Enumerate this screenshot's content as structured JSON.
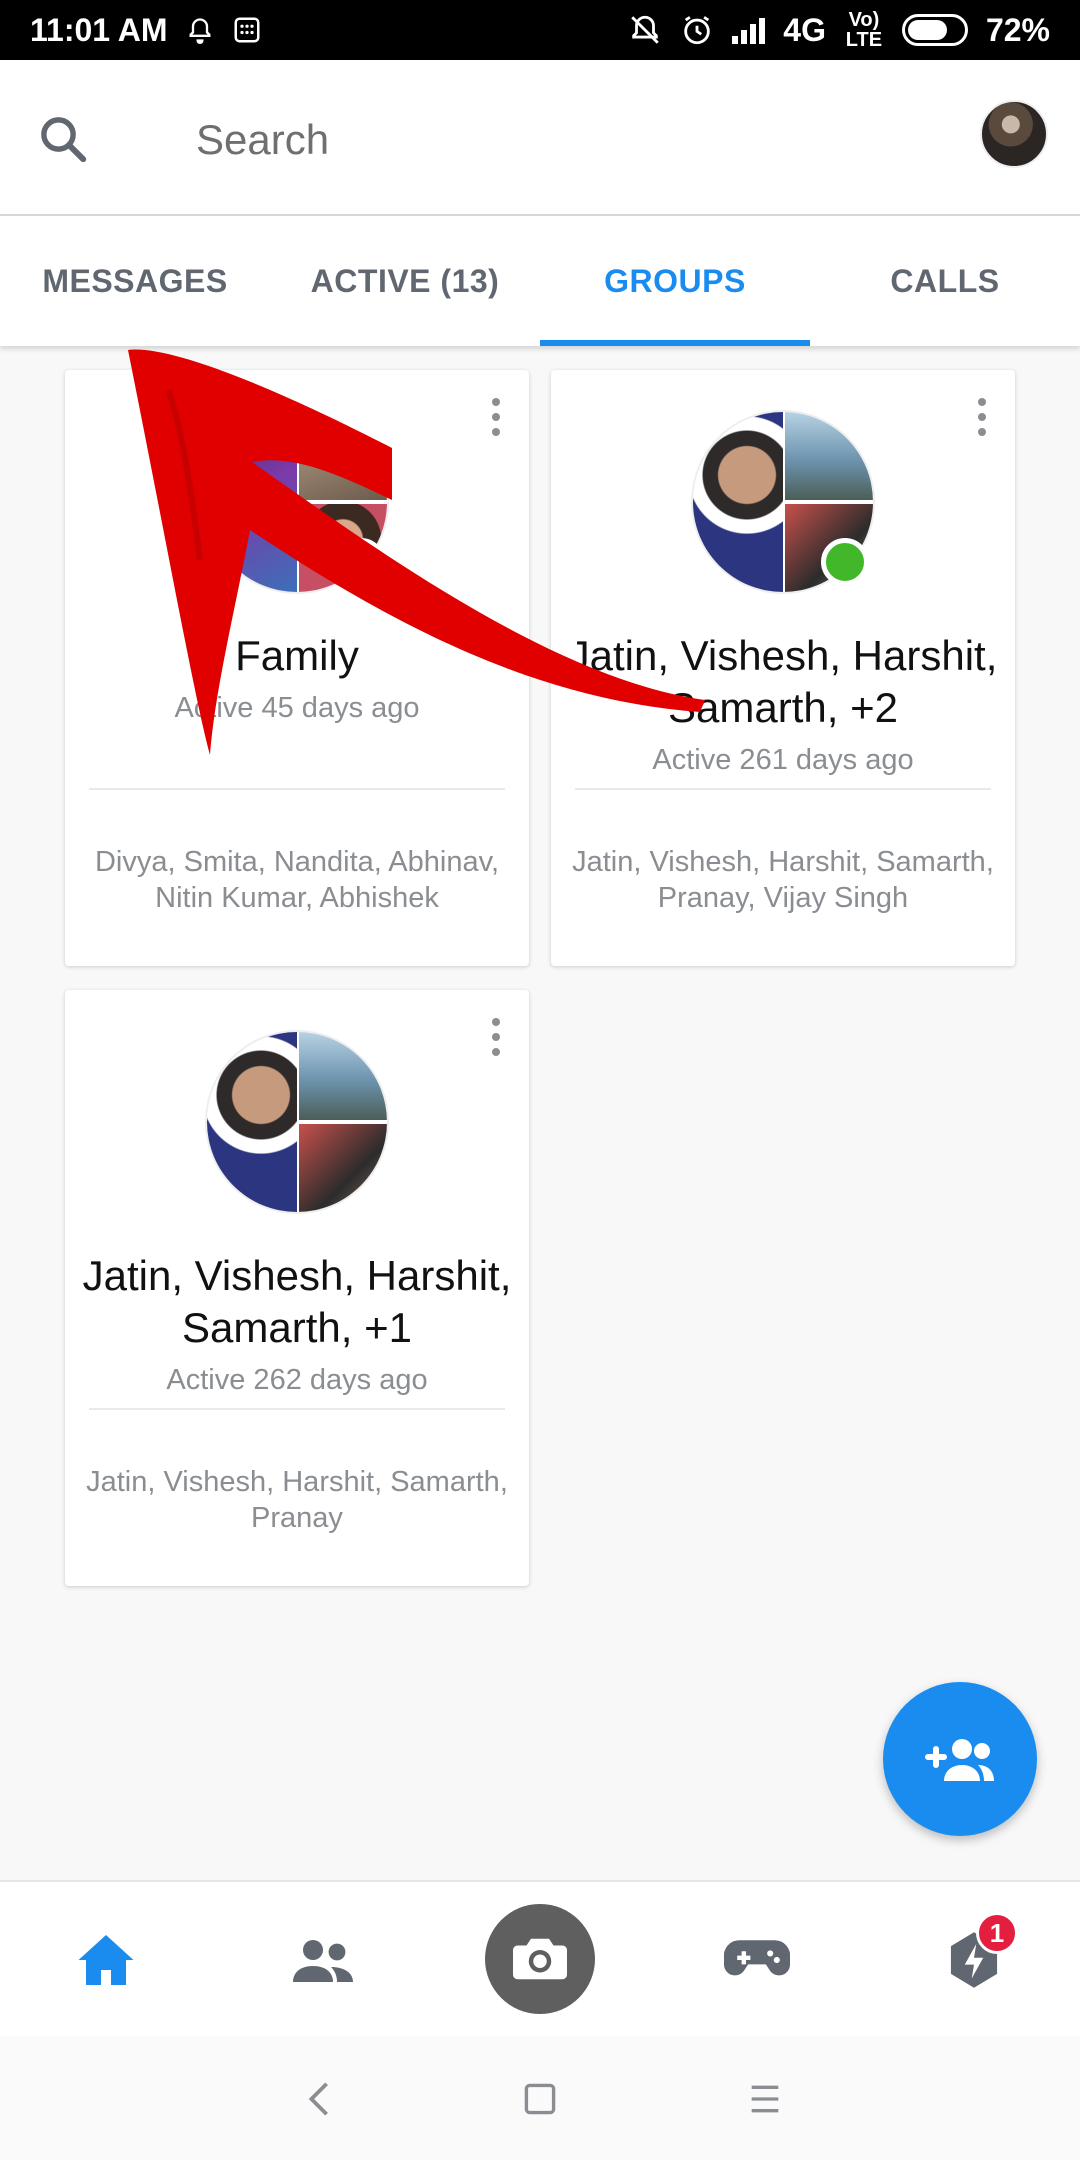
{
  "status_bar": {
    "time": "11:01 AM",
    "network": "4G",
    "volte": "Vo) LTE",
    "battery_percent": "72%",
    "battery_level": 0.72
  },
  "search": {
    "placeholder": "Search"
  },
  "tabs": [
    {
      "label": "MESSAGES",
      "active": false
    },
    {
      "label": "ACTIVE (13)",
      "active": false
    },
    {
      "label": "GROUPS",
      "active": true
    },
    {
      "label": "CALLS",
      "active": false
    }
  ],
  "groups": [
    {
      "title": "Family",
      "active": "Active 45 days ago",
      "members": "Divya, Smita, Nandita, Abhinav, Nitin Kumar, Abhishek",
      "online": true
    },
    {
      "title": "Jatin, Vishesh, Harshit, Samarth, +2",
      "active": "Active 261 days ago",
      "members": "Jatin, Vishesh, Harshit, Samarth, Pranay, Vijay Singh",
      "online": true
    },
    {
      "title": "Jatin, Vishesh, Harshit, Samarth, +1",
      "active": "Active 262 days ago",
      "members": "Jatin, Vishesh, Harshit, Samarth, Pranay",
      "online": false
    }
  ],
  "bottom_nav": {
    "items": [
      "home-icon",
      "people-icon",
      "camera-icon",
      "games-icon",
      "discover-icon"
    ],
    "badge_count": "1"
  },
  "colors": {
    "accent": "#1a8cf0",
    "online": "#42b72a",
    "badge": "#e41e3f",
    "annotation_arrow": "#e00000"
  }
}
